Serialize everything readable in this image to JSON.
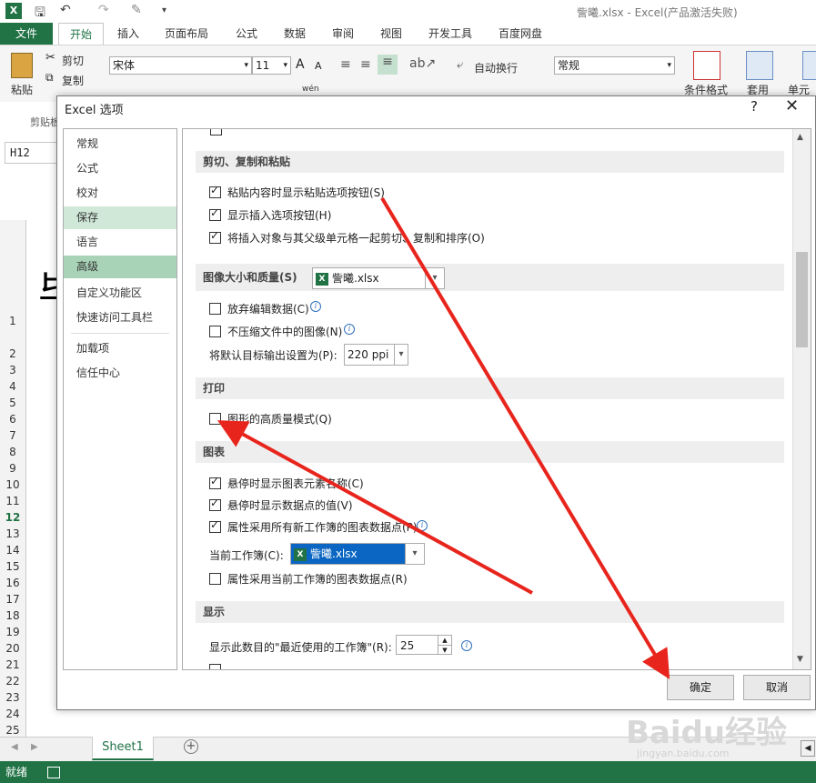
{
  "window": {
    "title": "訾曦.xlsx - Excel(产品激活失败)",
    "app_icon": "X"
  },
  "ribbon": {
    "file_tab": "文件",
    "tabs": [
      "开始",
      "插入",
      "页面布局",
      "公式",
      "数据",
      "审阅",
      "视图",
      "开发工具",
      "百度网盘"
    ],
    "paste": "粘贴",
    "cut": "剪切",
    "copy": "复制",
    "clipboard_group": "剪贴板",
    "font_name": "宋体",
    "font_size": "11",
    "wrap_text": "自动换行",
    "number_format": "常规",
    "conditional_format": "条件格式",
    "apply": "套用",
    "cell": "单元格",
    "font_a1": "A",
    "font_a2": "A",
    "wen": "wén"
  },
  "sheet": {
    "name_box": "H12",
    "rows": [
      "1",
      "2",
      "3",
      "4",
      "5",
      "6",
      "7",
      "8",
      "9",
      "10",
      "11",
      "12",
      "13",
      "14",
      "15",
      "16",
      "17",
      "18",
      "19",
      "20",
      "21",
      "22",
      "23",
      "24",
      "25"
    ],
    "big_char": "毕",
    "sheet_tab": "Sheet1",
    "status": "就绪"
  },
  "dialog": {
    "title": "Excel 选项",
    "help": "?",
    "close": "✕",
    "nav": [
      "常规",
      "公式",
      "校对",
      "保存",
      "语言",
      "高级",
      "自定义功能区",
      "快速访问工具栏",
      "加载项",
      "信任中心"
    ],
    "sections": {
      "cut_copy_paste": {
        "title": "剪切、复制和粘贴",
        "options": [
          {
            "label": "粘贴内容时显示粘贴选项按钮(S)",
            "checked": true
          },
          {
            "label": "显示插入选项按钮(H)",
            "checked": true
          },
          {
            "label": "将插入对象与其父级单元格一起剪切、复制和排序(O)",
            "checked": true
          }
        ]
      },
      "image": {
        "title": "图像大小和质量(S)",
        "workbook": "訾曦.xlsx",
        "options": [
          {
            "label": "放弃编辑数据(C)",
            "checked": false
          },
          {
            "label": "不压缩文件中的图像(N)",
            "checked": false
          }
        ],
        "ppi_label": "将默认目标输出设置为(P):",
        "ppi_value": "220 ppi"
      },
      "print": {
        "title": "打印",
        "options": [
          {
            "label": "图形的高质量模式(Q)",
            "checked": false
          }
        ]
      },
      "chart": {
        "title": "图表",
        "options": [
          {
            "label": "悬停时显示图表元素名称(C)",
            "checked": true
          },
          {
            "label": "悬停时显示数据点的值(V)",
            "checked": true
          },
          {
            "label": "属性采用所有新工作簿的图表数据点(P)",
            "checked": true
          }
        ],
        "current_wb_label": "当前工作簿(C):",
        "current_wb": "訾曦.xlsx",
        "last_option": {
          "label": "属性采用当前工作簿的图表数据点(R)",
          "checked": false
        }
      },
      "display": {
        "title": "显示",
        "recent_label": "显示此数目的\"最近使用的工作簿\"(R):",
        "recent_value": "25"
      }
    },
    "ok": "确定",
    "cancel": "取消"
  },
  "watermark": {
    "main": "Baidu经验",
    "sub": "jingyan.baidu.com"
  },
  "colors": {
    "excel_green": "#217346",
    "arrow_red": "#e8251d"
  }
}
